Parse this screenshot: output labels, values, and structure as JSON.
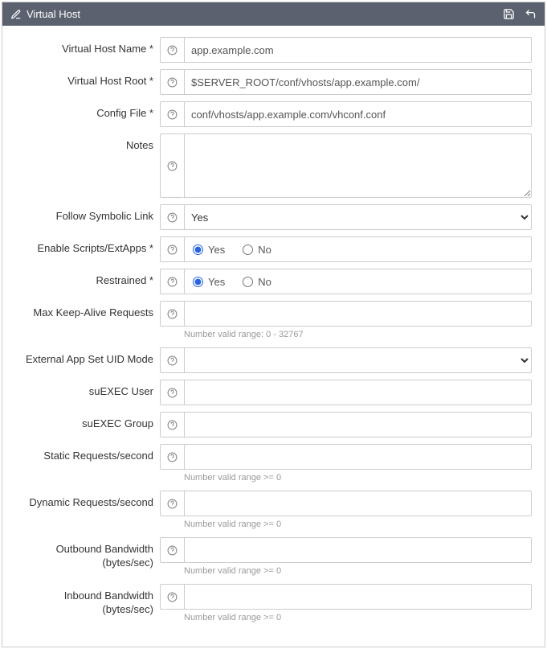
{
  "panel": {
    "title": "Virtual Host"
  },
  "fields": {
    "vhName": {
      "label": "Virtual Host Name *",
      "value": "app.example.com"
    },
    "vhRoot": {
      "label": "Virtual Host Root *",
      "value": "$SERVER_ROOT/conf/vhosts/app.example.com/"
    },
    "configFile": {
      "label": "Config File *",
      "value": "conf/vhosts/app.example.com/vhconf.conf"
    },
    "notes": {
      "label": "Notes",
      "value": ""
    },
    "followSym": {
      "label": "Follow Symbolic Link",
      "value": "Yes",
      "options": [
        "Yes"
      ]
    },
    "enableScripts": {
      "label": "Enable Scripts/ExtApps *",
      "yes": "Yes",
      "no": "No",
      "selected": "yes"
    },
    "restrained": {
      "label": "Restrained *",
      "yes": "Yes",
      "no": "No",
      "selected": "yes"
    },
    "maxKeepAlive": {
      "label": "Max Keep-Alive Requests",
      "value": "",
      "hint": "Number valid range: 0 - 32767"
    },
    "extAppUid": {
      "label": "External App Set UID Mode",
      "value": "",
      "options": [
        ""
      ]
    },
    "suexecUser": {
      "label": "suEXEC User",
      "value": ""
    },
    "suexecGroup": {
      "label": "suEXEC Group",
      "value": ""
    },
    "staticReq": {
      "label": "Static Requests/second",
      "value": "",
      "hint": "Number valid range >= 0"
    },
    "dynamicReq": {
      "label": "Dynamic Requests/second",
      "value": "",
      "hint": "Number valid range >= 0"
    },
    "outBw": {
      "label": "Outbound Bandwidth (bytes/sec)",
      "value": "",
      "hint": "Number valid range >= 0"
    },
    "inBw": {
      "label": "Inbound Bandwidth (bytes/sec)",
      "value": "",
      "hint": "Number valid range >= 0"
    }
  }
}
